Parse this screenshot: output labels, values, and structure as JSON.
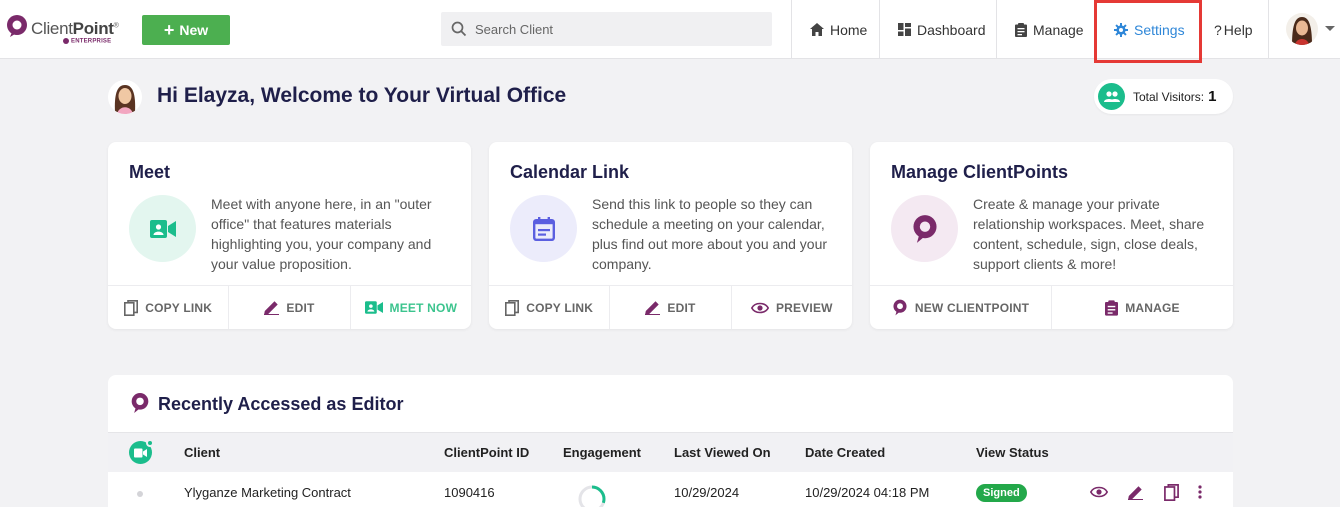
{
  "brand": {
    "name_light": "Client",
    "name_bold": "Point",
    "trademark": "®",
    "edition": "ENTERPRISE",
    "color": "#7a2a6a"
  },
  "header": {
    "new_button": "New",
    "search_placeholder": "Search Client",
    "nav": {
      "home": "Home",
      "dashboard": "Dashboard",
      "manage": "Manage",
      "settings": "Settings",
      "help": "Help",
      "help_prefix": "?"
    },
    "active_nav": "settings",
    "highlight_color": "#e53935"
  },
  "welcome": {
    "title": "Hi Elayza, Welcome to Your Virtual Office",
    "visitors_label": "Total Visitors:",
    "visitors_count": "1"
  },
  "cards": {
    "meet": {
      "title": "Meet",
      "description": "Meet with anyone here, in an \"outer office\" that features materials highlighting you, your company and your value proposition.",
      "icon": "video-camera-icon",
      "actions": {
        "copy": "COPY LINK",
        "edit": "EDIT",
        "meet_now": "MEET NOW"
      }
    },
    "calendar": {
      "title": "Calendar Link",
      "description": "Send this link to people so they can schedule a meeting on your calendar, plus find out more about you and your company.",
      "icon": "calendar-icon",
      "actions": {
        "copy": "COPY LINK",
        "edit": "EDIT",
        "preview": "PREVIEW"
      }
    },
    "clientpoints": {
      "title": "Manage ClientPoints",
      "description": "Create & manage your private relationship workspaces. Meet, share content, schedule, sign, close deals, support clients & more!",
      "icon": "clientpoint-logo-icon",
      "actions": {
        "new": "NEW CLIENTPOINT",
        "manage": "MANAGE"
      }
    }
  },
  "recent": {
    "title": "Recently Accessed as Editor",
    "columns": {
      "client": "Client",
      "id": "ClientPoint ID",
      "engagement": "Engagement",
      "last_viewed": "Last Viewed On",
      "created": "Date Created",
      "status": "View Status"
    },
    "rows": [
      {
        "client": "Ylyganze Marketing Contract",
        "id": "1090416",
        "engagement": 0.3,
        "last_viewed": "10/29/2024",
        "created": "10/29/2024 04:18 PM",
        "status": "Signed"
      }
    ]
  }
}
